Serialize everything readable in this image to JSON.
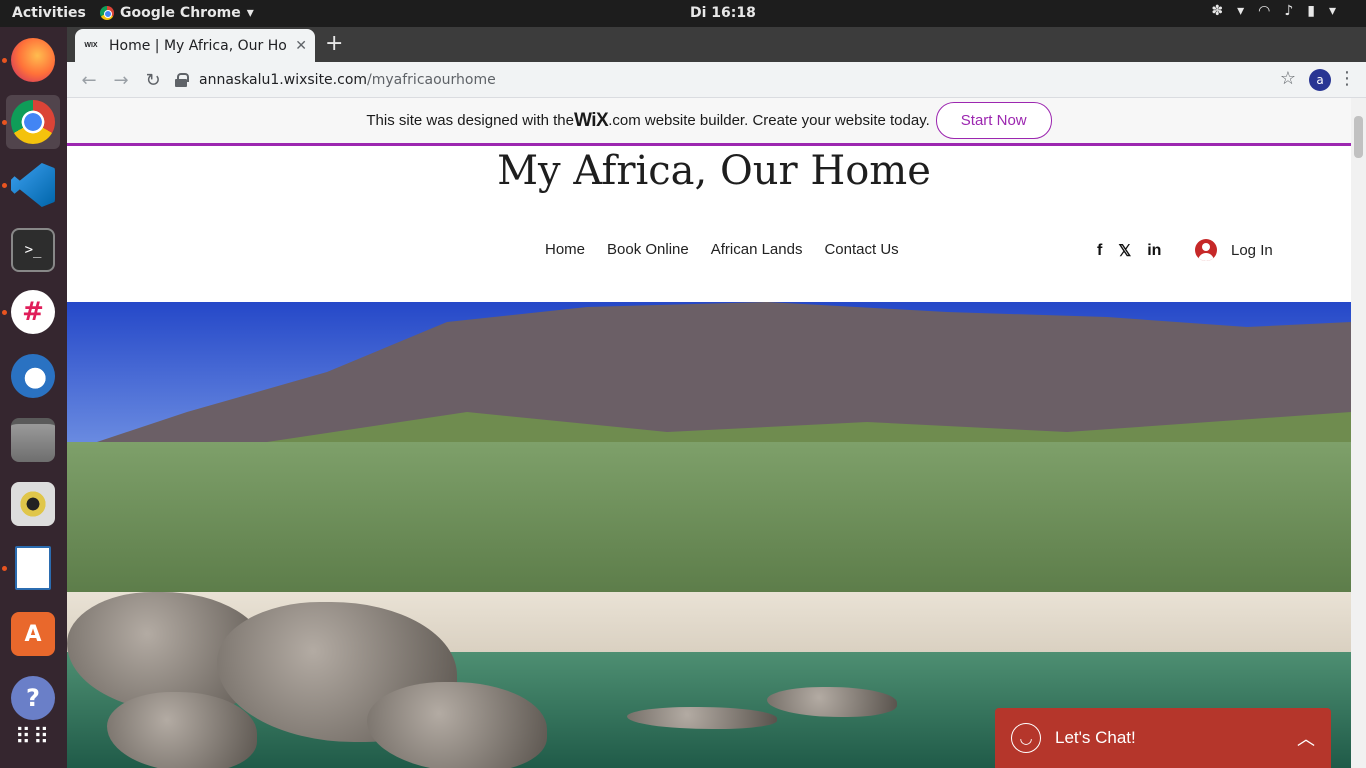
{
  "topbar": {
    "activities": "Activities",
    "app_name": "Google Chrome",
    "clock": "Di 16:18"
  },
  "dock": {
    "items": [
      {
        "name": "firefox",
        "color": "#ff7139"
      },
      {
        "name": "chrome",
        "color": "#4285f4"
      },
      {
        "name": "vscode",
        "color": "#1f8ad2"
      },
      {
        "name": "terminal",
        "color": "#2d2d2d"
      },
      {
        "name": "slack",
        "color": "#ffffff"
      },
      {
        "name": "thunderbird",
        "color": "#2a72c2"
      },
      {
        "name": "files",
        "color": "#8a8a8a"
      },
      {
        "name": "rhythmbox",
        "color": "#e0c64a"
      },
      {
        "name": "libreoffice-writer",
        "color": "#2b6cb0"
      },
      {
        "name": "software-center",
        "color": "#e9682c"
      },
      {
        "name": "help",
        "color": "#6a7fc8"
      },
      {
        "name": "show-apps",
        "color": "#ffffff"
      }
    ]
  },
  "browser": {
    "tab_title": "Home | My Africa, Our Ho",
    "tab_favicon": "WIX",
    "url_host": "annaskalu1.wixsite.com",
    "url_path": "/myafricaourhome",
    "avatar_letter": "a"
  },
  "wix_banner": {
    "text_before": "This site was designed with the ",
    "logo": "WiX",
    "text_after": ".com website builder. Create your website today.",
    "button": "Start Now"
  },
  "site": {
    "title": "My Africa, Our Home",
    "nav": [
      "Home",
      "Book Online",
      "African Lands",
      "Contact Us"
    ],
    "social": [
      "f",
      "𝕏",
      "in"
    ],
    "login": "Log In"
  },
  "chat": {
    "label": "Let's Chat!"
  }
}
